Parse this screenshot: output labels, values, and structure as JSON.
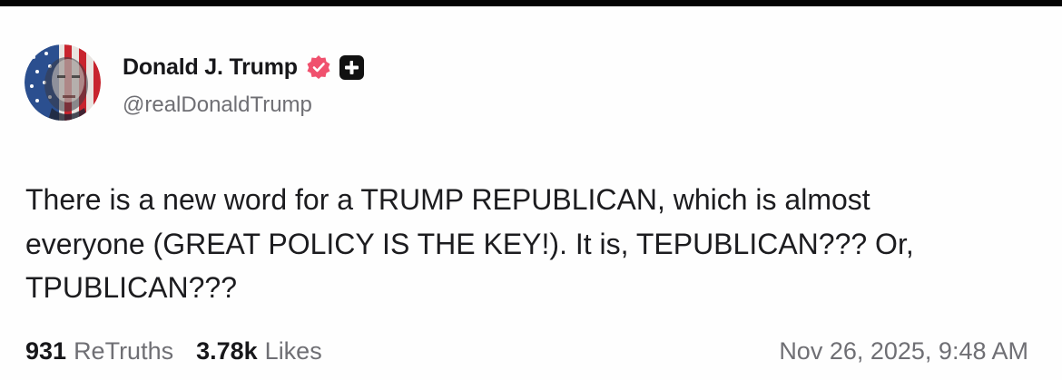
{
  "author": {
    "display_name": "Donald J. Trump",
    "handle": "@realDonaldTrump",
    "verified": true
  },
  "post": {
    "lines": [
      "There is a new word for a TRUMP REPUBLICAN, which is almost",
      "everyone (GREAT POLICY IS THE KEY!). It is, TEPUBLICAN??? Or,",
      "TPUBLICAN???"
    ]
  },
  "stats": {
    "retruths_count": "931",
    "retruths_label": "ReTruths",
    "likes_count": "3.78k",
    "likes_label": "Likes"
  },
  "timestamp": "Nov 26, 2025, 9:48 AM",
  "icons": {
    "avatar": "avatar-flag-portrait",
    "verified": "verified-badge-icon",
    "plus": "plus-badge-icon"
  },
  "colors": {
    "verified_badge": "#f0516e",
    "plus_badge": "#111111",
    "text_primary": "#17171a",
    "text_secondary": "#6f6f74"
  }
}
